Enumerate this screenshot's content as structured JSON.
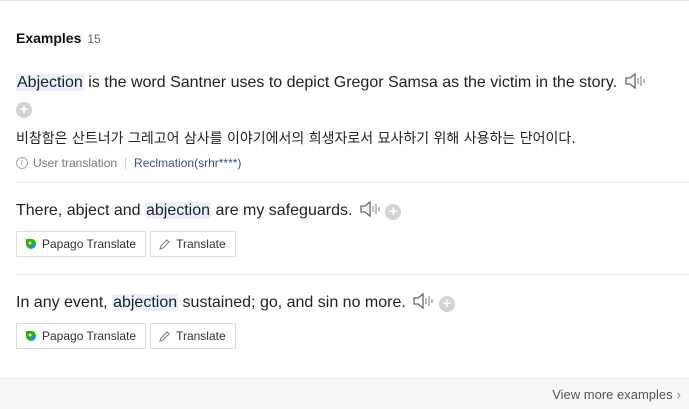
{
  "section": {
    "title": "Examples",
    "count": "15"
  },
  "examples": [
    {
      "sentence": {
        "highlight": "Abjection",
        "after": " is the word Santner uses to depict Gregor Samsa as the victim in the story."
      },
      "translation": "비참함은 산트너가 그레고어 삼사를 이야기에서의 희생자로서 묘사하기 위해 사용하는 단어이다.",
      "meta": {
        "source_label": "User translation",
        "contributor": "Reclmation(srhr****)"
      }
    },
    {
      "sentence": {
        "before": "There, abject and ",
        "highlight": "abjection",
        "after": " are my safeguards."
      },
      "buttons": {
        "papago": "Papago Translate",
        "translate": "Translate"
      }
    },
    {
      "sentence": {
        "before": "In any event, ",
        "highlight": "abjection",
        "after": " sustained; go, and sin no more."
      },
      "buttons": {
        "papago": "Papago Translate",
        "translate": "Translate"
      }
    }
  ],
  "footer": {
    "view_more": "View more examples"
  },
  "icons": {
    "speaker": "speaker-icon",
    "add": "plus-circle-icon",
    "info": "info-icon",
    "papago": "papago-logo-icon",
    "pen": "pencil-icon",
    "chevron": "chevron-right-icon"
  },
  "colors": {
    "highlight_bg": "#e9f2ff",
    "contributor": "#3a4f7a",
    "papago_green": "#2db400",
    "papago_blue": "#1d8cf8"
  }
}
